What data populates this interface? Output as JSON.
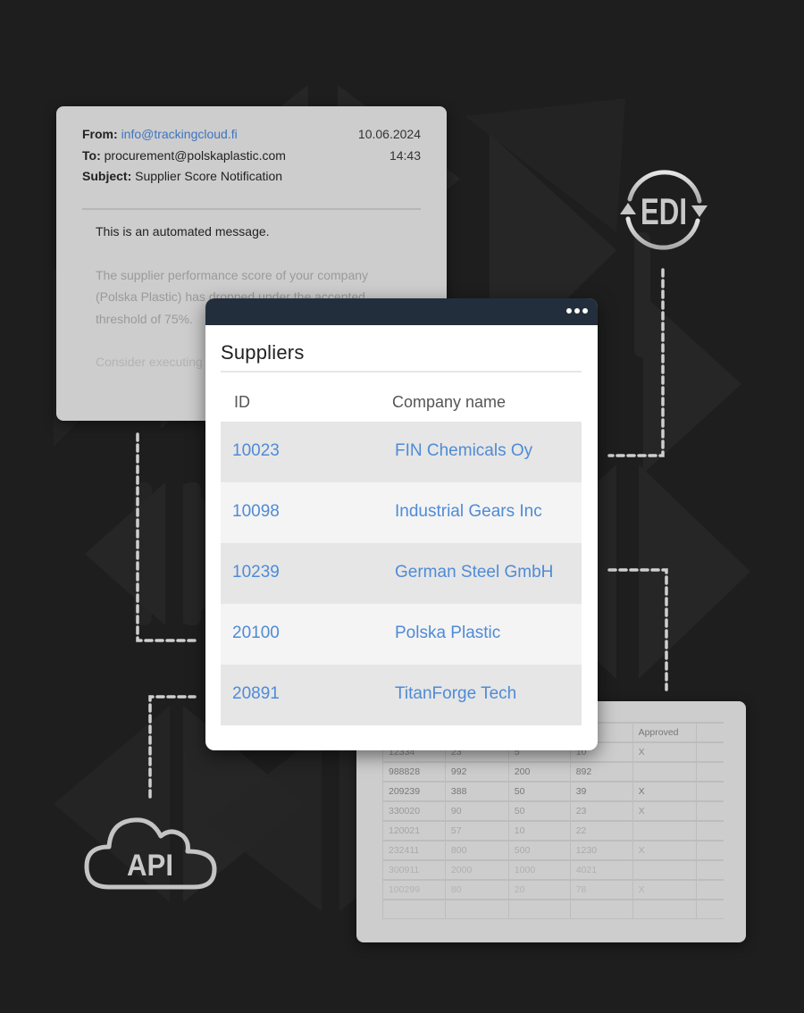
{
  "email": {
    "from_label": "From:",
    "from_value": "info@trackingcloud.fi",
    "to_label": "To:",
    "to_value": "procurement@polskaplastic.com",
    "subject_label": "Subject:",
    "subject_value": "Supplier Score Notification",
    "date": "10.06.2024",
    "time": "14:43",
    "body": [
      "This is an automated message.",
      "The supplier performance score of your company (Polska Plastic) has dropped under the accepted threshold of 75%.",
      "Consider executing ... improve your score"
    ]
  },
  "suppliers": {
    "title": "Suppliers",
    "menu_icon": "more-horizontal-icon",
    "columns": [
      "ID",
      "Company name"
    ],
    "rows": [
      {
        "id": "10023",
        "name": "FIN Chemicals Oy"
      },
      {
        "id": "10098",
        "name": "Industrial Gears Inc"
      },
      {
        "id": "10239",
        "name": "German Steel GmbH"
      },
      {
        "id": "20100",
        "name": "Polska Plastic"
      },
      {
        "id": "20891",
        "name": "TitanForge Tech"
      }
    ],
    "link_color": "#4f8bd6",
    "titlebar_color": "#222e3b"
  },
  "inventory": {
    "columns": [
      "",
      "",
      "",
      "ock",
      "Approved",
      ""
    ],
    "rows": [
      [
        "12334",
        "23",
        "5",
        "10",
        "X",
        ""
      ],
      [
        "988828",
        "992",
        "200",
        "892",
        "",
        ""
      ],
      [
        "209239",
        "388",
        "50",
        "39",
        "X",
        ""
      ],
      [
        "330020",
        "90",
        "50",
        "23",
        "X",
        ""
      ],
      [
        "120021",
        "57",
        "10",
        "22",
        "",
        ""
      ],
      [
        "232411",
        "800",
        "500",
        "1230",
        "X",
        ""
      ],
      [
        "300911",
        "2000",
        "1000",
        "4021",
        "",
        ""
      ],
      [
        "100299",
        "80",
        "20",
        "78",
        "X",
        ""
      ],
      [
        "",
        "",
        "",
        "",
        "",
        ""
      ]
    ]
  },
  "icons": {
    "edi_label": "EDI",
    "api_label": "API"
  }
}
